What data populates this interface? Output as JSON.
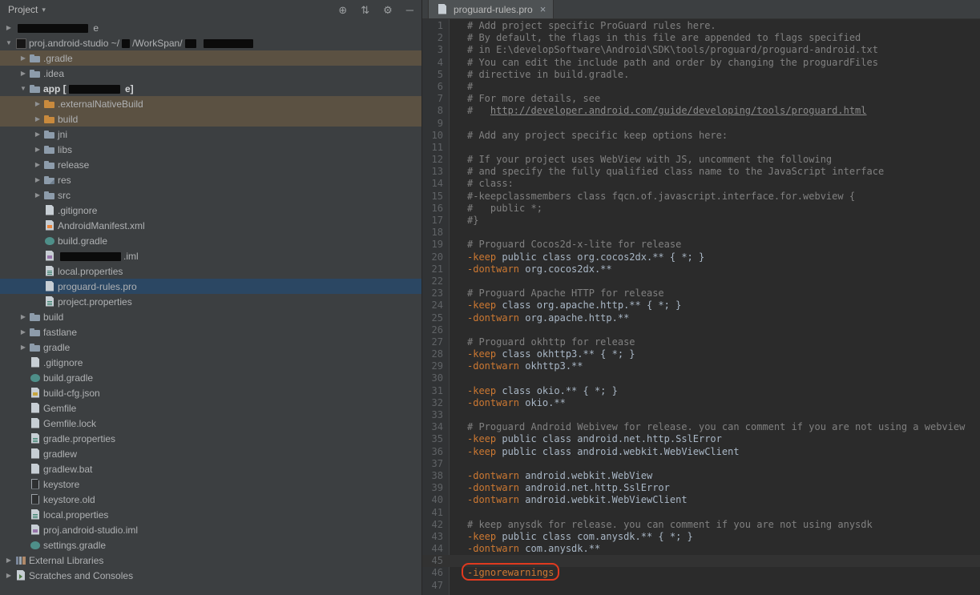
{
  "colors": {
    "panel_bg": "#3c3f41",
    "editor_bg": "#2b2b2b",
    "gutter_bg": "#313335",
    "selection_row": "#2b4763",
    "modified_row": "#5b5142",
    "directive": "#cc7832",
    "comment": "#808080",
    "code": "#a9b7c6",
    "line_number": "#606366",
    "annotation_box": "#e03a1f"
  },
  "panel_header": {
    "title": "Project",
    "caret": "▾",
    "icons": [
      {
        "name": "locate-icon",
        "glyph": "⊕"
      },
      {
        "name": "collapse-all-icon",
        "glyph": "⇅"
      },
      {
        "name": "settings-gear-icon",
        "glyph": "⚙"
      },
      {
        "name": "hide-panel-icon",
        "glyph": "─"
      }
    ]
  },
  "tree": [
    {
      "name": "tree-item-redacted-module",
      "indent": 0,
      "arrow": "right",
      "icon": null,
      "parts": [
        {
          "redact": 88
        },
        {
          "text": " e"
        }
      ]
    },
    {
      "name": "tree-item-project-root",
      "indent": 0,
      "arrow": "down",
      "icon": "module-dark",
      "parts": [
        {
          "text": "proj.android-studio ~/"
        },
        {
          "redact": 10
        },
        {
          "text": "/WorkSpan/"
        },
        {
          "redact": 14
        },
        {
          "text": "  "
        },
        {
          "redact": 62
        }
      ]
    },
    {
      "name": "tree-item-gradle-dir",
      "indent": 1,
      "arrow": "right",
      "icon": "folder",
      "hl": "warm",
      "parts": [
        {
          "text": ".gradle"
        }
      ]
    },
    {
      "name": "tree-item-idea-dir",
      "indent": 1,
      "arrow": "right",
      "icon": "folder",
      "parts": [
        {
          "text": ".idea"
        }
      ]
    },
    {
      "name": "tree-item-app",
      "indent": 1,
      "arrow": "down",
      "icon": "folder",
      "bold": true,
      "parts": [
        {
          "text": "app ["
        },
        {
          "redact": 64
        },
        {
          "text": " e]"
        }
      ]
    },
    {
      "name": "tree-item-externalnativebuild",
      "indent": 2,
      "arrow": "right",
      "icon": "folder-orange",
      "hl": "warm",
      "parts": [
        {
          "text": ".externalNativeBuild"
        }
      ]
    },
    {
      "name": "tree-item-app-build",
      "indent": 2,
      "arrow": "right",
      "icon": "folder-orange",
      "hl": "warm",
      "parts": [
        {
          "text": "build"
        }
      ]
    },
    {
      "name": "tree-item-jni",
      "indent": 2,
      "arrow": "right",
      "icon": "folder",
      "parts": [
        {
          "text": "jni"
        }
      ]
    },
    {
      "name": "tree-item-libs",
      "indent": 2,
      "arrow": "right",
      "icon": "folder",
      "parts": [
        {
          "text": "libs"
        }
      ]
    },
    {
      "name": "tree-item-release",
      "indent": 2,
      "arrow": "right",
      "icon": "folder",
      "parts": [
        {
          "text": "release"
        }
      ]
    },
    {
      "name": "tree-item-res",
      "indent": 2,
      "arrow": "right",
      "icon": "folder-res",
      "parts": [
        {
          "text": "res"
        }
      ]
    },
    {
      "name": "tree-item-src",
      "indent": 2,
      "arrow": "right",
      "icon": "folder",
      "parts": [
        {
          "text": "src"
        }
      ]
    },
    {
      "name": "tree-item-app-gitignore",
      "indent": 2,
      "arrow": null,
      "icon": "file",
      "parts": [
        {
          "text": ".gitignore"
        }
      ]
    },
    {
      "name": "tree-item-androidmanifest",
      "indent": 2,
      "arrow": null,
      "icon": "file-xml",
      "parts": [
        {
          "text": "AndroidManifest.xml"
        }
      ]
    },
    {
      "name": "tree-item-app-build-gradle",
      "indent": 2,
      "arrow": null,
      "icon": "gradle",
      "parts": [
        {
          "text": "build.gradle"
        }
      ]
    },
    {
      "name": "tree-item-redacted-iml",
      "indent": 2,
      "arrow": null,
      "icon": "file-iml",
      "parts": [
        {
          "redact": 76
        },
        {
          "text": ".iml"
        }
      ]
    },
    {
      "name": "tree-item-app-local-properties",
      "indent": 2,
      "arrow": null,
      "icon": "file-properties",
      "parts": [
        {
          "text": "local.properties"
        }
      ]
    },
    {
      "name": "tree-item-proguard-rules",
      "indent": 2,
      "arrow": null,
      "icon": "file",
      "hl": "sel",
      "parts": [
        {
          "text": "proguard-rules.pro"
        }
      ]
    },
    {
      "name": "tree-item-project-properties",
      "indent": 2,
      "arrow": null,
      "icon": "file-properties",
      "parts": [
        {
          "text": "project.properties"
        }
      ]
    },
    {
      "name": "tree-item-build-dir",
      "indent": 1,
      "arrow": "right",
      "icon": "folder",
      "parts": [
        {
          "text": "build"
        }
      ]
    },
    {
      "name": "tree-item-fastlane",
      "indent": 1,
      "arrow": "right",
      "icon": "folder",
      "parts": [
        {
          "text": "fastlane"
        }
      ]
    },
    {
      "name": "tree-item-gradle-folder",
      "indent": 1,
      "arrow": "right",
      "icon": "folder",
      "parts": [
        {
          "text": "gradle"
        }
      ]
    },
    {
      "name": "tree-item-gitignore",
      "indent": 1,
      "arrow": null,
      "icon": "file",
      "parts": [
        {
          "text": ".gitignore"
        }
      ]
    },
    {
      "name": "tree-item-build-gradle",
      "indent": 1,
      "arrow": null,
      "icon": "gradle",
      "parts": [
        {
          "text": "build.gradle"
        }
      ]
    },
    {
      "name": "tree-item-build-cfg-json",
      "indent": 1,
      "arrow": null,
      "icon": "file-json",
      "parts": [
        {
          "text": "build-cfg.json"
        }
      ]
    },
    {
      "name": "tree-item-gemfile",
      "indent": 1,
      "arrow": null,
      "icon": "file",
      "parts": [
        {
          "text": "Gemfile"
        }
      ]
    },
    {
      "name": "tree-item-gemfile-lock",
      "indent": 1,
      "arrow": null,
      "icon": "file",
      "parts": [
        {
          "text": "Gemfile.lock"
        }
      ]
    },
    {
      "name": "tree-item-gradle-properties",
      "indent": 1,
      "arrow": null,
      "icon": "file-properties",
      "parts": [
        {
          "text": "gradle.properties"
        }
      ]
    },
    {
      "name": "tree-item-gradlew",
      "indent": 1,
      "arrow": null,
      "icon": "file",
      "parts": [
        {
          "text": "gradlew"
        }
      ]
    },
    {
      "name": "tree-item-gradlew-bat",
      "indent": 1,
      "arrow": null,
      "icon": "file",
      "parts": [
        {
          "text": "gradlew.bat"
        }
      ]
    },
    {
      "name": "tree-item-keystore",
      "indent": 1,
      "arrow": null,
      "icon": "file-dark",
      "parts": [
        {
          "text": "keystore"
        }
      ]
    },
    {
      "name": "tree-item-keystore-old",
      "indent": 1,
      "arrow": null,
      "icon": "file-dark",
      "parts": [
        {
          "text": "keystore.old"
        }
      ]
    },
    {
      "name": "tree-item-local-properties",
      "indent": 1,
      "arrow": null,
      "icon": "file-properties",
      "parts": [
        {
          "text": "local.properties"
        }
      ]
    },
    {
      "name": "tree-item-proj-android-studio-iml",
      "indent": 1,
      "arrow": null,
      "icon": "file-iml",
      "parts": [
        {
          "text": "proj.android-studio.iml"
        }
      ]
    },
    {
      "name": "tree-item-settings-gradle",
      "indent": 1,
      "arrow": null,
      "icon": "gradle",
      "parts": [
        {
          "text": "settings.gradle"
        }
      ]
    },
    {
      "name": "tree-item-external-libraries",
      "indent": 0,
      "arrow": "right",
      "icon": "library",
      "parts": [
        {
          "text": "External Libraries"
        }
      ]
    },
    {
      "name": "tree-item-scratches-consoles",
      "indent": 0,
      "arrow": "right",
      "icon": "console",
      "parts": [
        {
          "text": "Scratches and Consoles"
        }
      ]
    }
  ],
  "editor": {
    "tab": {
      "label": "proguard-rules.pro",
      "close": "×"
    },
    "lines": [
      {
        "n": 1,
        "seg": [
          {
            "c": "comment",
            "t": "# Add project specific ProGuard rules here."
          }
        ]
      },
      {
        "n": 2,
        "seg": [
          {
            "c": "comment",
            "t": "# By default, the flags in this file are appended to flags specified"
          }
        ]
      },
      {
        "n": 3,
        "seg": [
          {
            "c": "comment",
            "t": "# in E:\\developSoftware\\Android\\SDK\\tools/proguard/proguard-android.txt"
          }
        ]
      },
      {
        "n": 4,
        "seg": [
          {
            "c": "comment",
            "t": "# You can edit the include path and order by changing the proguardFiles"
          }
        ]
      },
      {
        "n": 5,
        "seg": [
          {
            "c": "comment",
            "t": "# directive in build.gradle."
          }
        ]
      },
      {
        "n": 6,
        "seg": [
          {
            "c": "comment",
            "t": "#"
          }
        ]
      },
      {
        "n": 7,
        "seg": [
          {
            "c": "comment",
            "t": "# For more details, see"
          }
        ]
      },
      {
        "n": 8,
        "seg": [
          {
            "c": "comment",
            "t": "#   "
          },
          {
            "c": "url",
            "t": "http://developer.android.com/guide/developing/tools/proguard.html"
          }
        ]
      },
      {
        "n": 9,
        "seg": []
      },
      {
        "n": 10,
        "seg": [
          {
            "c": "comment",
            "t": "# Add any project specific keep options here:"
          }
        ]
      },
      {
        "n": 11,
        "seg": []
      },
      {
        "n": 12,
        "seg": [
          {
            "c": "comment",
            "t": "# If your project uses WebView with JS, uncomment the following"
          }
        ]
      },
      {
        "n": 13,
        "seg": [
          {
            "c": "comment",
            "t": "# and specify the fully qualified class name to the JavaScript interface"
          }
        ]
      },
      {
        "n": 14,
        "seg": [
          {
            "c": "comment",
            "t": "# class:"
          }
        ]
      },
      {
        "n": 15,
        "seg": [
          {
            "c": "comment",
            "t": "#-keepclassmembers class fqcn.of.javascript.interface.for.webview {"
          }
        ]
      },
      {
        "n": 16,
        "seg": [
          {
            "c": "comment",
            "t": "#   public *;"
          }
        ]
      },
      {
        "n": 17,
        "seg": [
          {
            "c": "comment",
            "t": "#}"
          }
        ]
      },
      {
        "n": 18,
        "seg": []
      },
      {
        "n": 19,
        "seg": [
          {
            "c": "comment",
            "t": "# Proguard Cocos2d-x-lite for release"
          }
        ]
      },
      {
        "n": 20,
        "seg": [
          {
            "c": "dir",
            "t": "-keep"
          },
          {
            "c": "code",
            "t": " public class org.cocos2dx.** { *; }"
          }
        ]
      },
      {
        "n": 21,
        "seg": [
          {
            "c": "dir",
            "t": "-dontwarn"
          },
          {
            "c": "code",
            "t": " org.cocos2dx.**"
          }
        ]
      },
      {
        "n": 22,
        "seg": []
      },
      {
        "n": 23,
        "seg": [
          {
            "c": "comment",
            "t": "# Proguard Apache HTTP for release"
          }
        ]
      },
      {
        "n": 24,
        "seg": [
          {
            "c": "dir",
            "t": "-keep"
          },
          {
            "c": "code",
            "t": " class org.apache.http.** { *; }"
          }
        ]
      },
      {
        "n": 25,
        "seg": [
          {
            "c": "dir",
            "t": "-dontwarn"
          },
          {
            "c": "code",
            "t": " org.apache.http.**"
          }
        ]
      },
      {
        "n": 26,
        "seg": []
      },
      {
        "n": 27,
        "seg": [
          {
            "c": "comment",
            "t": "# Proguard okhttp for release"
          }
        ]
      },
      {
        "n": 28,
        "seg": [
          {
            "c": "dir",
            "t": "-keep"
          },
          {
            "c": "code",
            "t": " class okhttp3.** { *; }"
          }
        ]
      },
      {
        "n": 29,
        "seg": [
          {
            "c": "dir",
            "t": "-dontwarn"
          },
          {
            "c": "code",
            "t": " okhttp3.**"
          }
        ]
      },
      {
        "n": 30,
        "seg": []
      },
      {
        "n": 31,
        "seg": [
          {
            "c": "dir",
            "t": "-keep"
          },
          {
            "c": "code",
            "t": " class okio.** { *; }"
          }
        ]
      },
      {
        "n": 32,
        "seg": [
          {
            "c": "dir",
            "t": "-dontwarn"
          },
          {
            "c": "code",
            "t": " okio.**"
          }
        ]
      },
      {
        "n": 33,
        "seg": []
      },
      {
        "n": 34,
        "seg": [
          {
            "c": "comment",
            "t": "# Proguard Android Webivew for release. you can comment if you are not using a webview"
          }
        ]
      },
      {
        "n": 35,
        "seg": [
          {
            "c": "dir",
            "t": "-keep"
          },
          {
            "c": "code",
            "t": " public class android.net.http.SslError"
          }
        ]
      },
      {
        "n": 36,
        "seg": [
          {
            "c": "dir",
            "t": "-keep"
          },
          {
            "c": "code",
            "t": " public class android.webkit.WebViewClient"
          }
        ]
      },
      {
        "n": 37,
        "seg": []
      },
      {
        "n": 38,
        "seg": [
          {
            "c": "dir",
            "t": "-dontwarn"
          },
          {
            "c": "code",
            "t": " android.webkit.WebView"
          }
        ]
      },
      {
        "n": 39,
        "seg": [
          {
            "c": "dir",
            "t": "-dontwarn"
          },
          {
            "c": "code",
            "t": " android.net.http.SslError"
          }
        ]
      },
      {
        "n": 40,
        "seg": [
          {
            "c": "dir",
            "t": "-dontwarn"
          },
          {
            "c": "code",
            "t": " android.webkit.WebViewClient"
          }
        ]
      },
      {
        "n": 41,
        "seg": []
      },
      {
        "n": 42,
        "seg": [
          {
            "c": "comment",
            "t": "# keep anysdk for release. you can comment if you are not using anysdk"
          }
        ]
      },
      {
        "n": 43,
        "seg": [
          {
            "c": "dir",
            "t": "-keep"
          },
          {
            "c": "code",
            "t": " public class com.anysdk.** { *; }"
          }
        ]
      },
      {
        "n": 44,
        "seg": [
          {
            "c": "dir",
            "t": "-dontwarn"
          },
          {
            "c": "code",
            "t": " com.anysdk.**"
          }
        ]
      },
      {
        "n": 45,
        "seg": [],
        "caret": true
      },
      {
        "n": 46,
        "seg": [
          {
            "c": "dir",
            "t": "-ignorewarnings",
            "boxed": true
          }
        ]
      },
      {
        "n": 47,
        "seg": []
      }
    ]
  }
}
